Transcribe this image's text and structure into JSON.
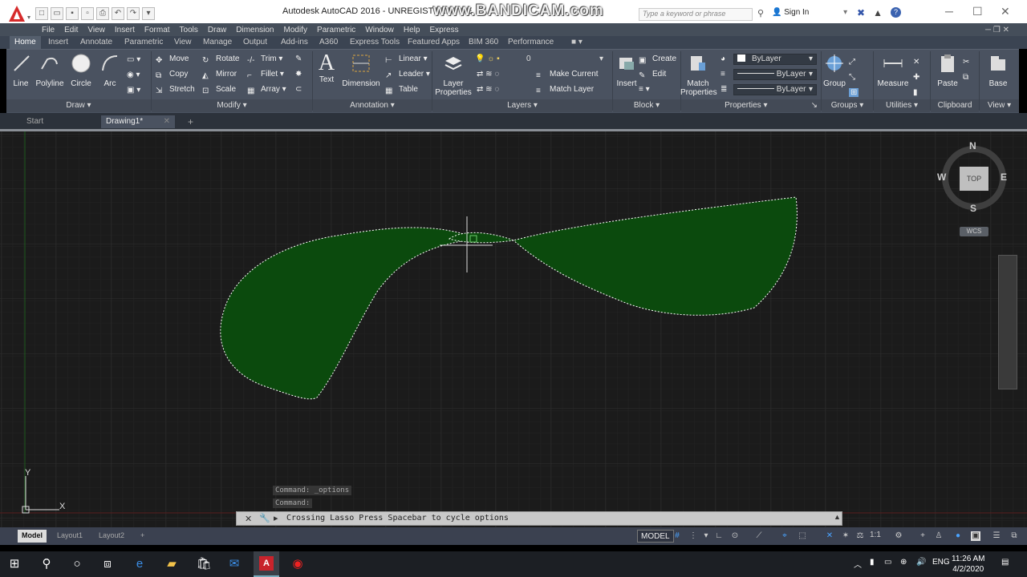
{
  "titlebar": {
    "title": "Autodesk AutoCAD 2016 - UNREGISTERED VE",
    "watermark": "www.BANDICAM.com",
    "search_placeholder": "Type a keyword or phrase",
    "signin": "Sign In"
  },
  "menu": [
    "File",
    "Edit",
    "View",
    "Insert",
    "Format",
    "Tools",
    "Draw",
    "Dimension",
    "Modify",
    "Parametric",
    "Window",
    "Help",
    "Express"
  ],
  "ribbon_tabs": [
    "Home",
    "Insert",
    "Annotate",
    "Parametric",
    "View",
    "Manage",
    "Output",
    "Add-ins",
    "A360",
    "Express Tools",
    "Featured Apps",
    "BIM 360",
    "Performance"
  ],
  "panels": {
    "draw": {
      "label": "Draw",
      "line": "Line",
      "polyline": "Polyline",
      "circle": "Circle",
      "arc": "Arc"
    },
    "modify": {
      "label": "Modify",
      "move": "Move",
      "rotate": "Rotate",
      "trim": "Trim",
      "copy": "Copy",
      "mirror": "Mirror",
      "fillet": "Fillet",
      "stretch": "Stretch",
      "scale": "Scale",
      "array": "Array"
    },
    "annotation": {
      "label": "Annotation",
      "text": "Text",
      "dimension": "Dimension",
      "linear": "Linear",
      "leader": "Leader",
      "table": "Table"
    },
    "layers": {
      "label": "Layers",
      "layer_properties_1": "Layer",
      "layer_properties_2": "Properties",
      "current_layer": "0",
      "make_current": "Make Current",
      "match_layer": "Match Layer"
    },
    "block": {
      "label": "Block",
      "insert": "Insert",
      "create": "Create",
      "edit": "Edit"
    },
    "properties": {
      "label": "Properties",
      "match_1": "Match",
      "match_2": "Properties",
      "color": "ByLayer",
      "linetype": "ByLayer",
      "lineweight": "ByLayer"
    },
    "groups": {
      "label": "Groups",
      "group": "Group"
    },
    "utilities": {
      "label": "Utilities",
      "measure": "Measure"
    },
    "clipboard": {
      "label": "Clipboard",
      "paste": "Paste"
    },
    "view": {
      "label": "View",
      "base": "Base"
    }
  },
  "doc_tabs": {
    "start": "Start",
    "drawing": "Drawing1*"
  },
  "viewcube": {
    "n": "N",
    "s": "S",
    "e": "E",
    "w": "W",
    "top": "TOP",
    "wcs": "WCS"
  },
  "ucs": {
    "x": "X",
    "y": "Y"
  },
  "command": {
    "history_1": "Command: _options",
    "history_2": "Command:",
    "prompt": "Crossing Lasso  Press Spacebar to cycle options"
  },
  "layout_tabs": [
    "Model",
    "Layout1",
    "Layout2"
  ],
  "status": {
    "model": "MODEL",
    "scale": "1:1"
  },
  "taskbar": {
    "lang": "ENG",
    "time": "11:26 AM",
    "date": "4/2/2020"
  },
  "colors": {
    "lasso_fill": "#0b4a0d",
    "ribbon": "#4a5260",
    "canvas": "#1b1b1b"
  }
}
